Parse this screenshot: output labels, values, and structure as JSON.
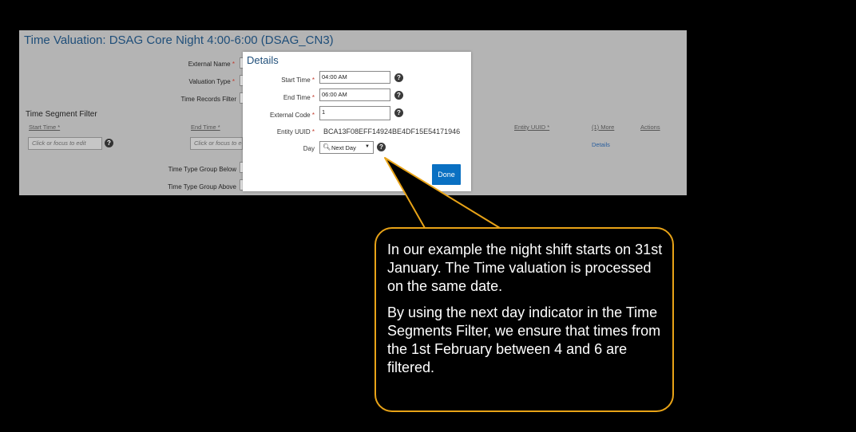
{
  "page": {
    "title": "Time Valuation: DSAG Core Night 4:00-6:00 (DSAG_CN3)"
  },
  "form": {
    "external_name_label": "External Name",
    "valuation_type_label": "Valuation Type",
    "time_records_filter_label": "Time Records Filter",
    "time_type_group_below_label": "Time Type Group Below",
    "time_type_group_above_label": "Time Type Group Above",
    "required_mark": "*"
  },
  "segment_filter": {
    "title": "Time Segment Filter",
    "columns": {
      "start_time": "Start Time *",
      "end_time": "End Time *",
      "entity_uuid": "Entity UUID *",
      "more": "(1) More",
      "actions": "Actions"
    },
    "start_placeholder": "Click or focus to edit",
    "end_placeholder": "Click or focus to edit",
    "details_link": "Details",
    "help": "?"
  },
  "dialog": {
    "title": "Details",
    "start_time_label": "Start Time",
    "start_time_value": "04:00 AM",
    "end_time_label": "End Time",
    "end_time_value": "06:00 AM",
    "external_code_label": "External Code",
    "external_code_value": "1",
    "entity_uuid_label": "Entity UUID",
    "entity_uuid_value": "BCA13F08EFF14924BE4DF15E54171946",
    "day_label": "Day",
    "day_value": "Next Day",
    "done_label": "Done",
    "required_mark": "*",
    "help": "?"
  },
  "callout": {
    "paragraph1": "In our example the night shift starts on 31st January. The Time valuation is processed on the same date.",
    "paragraph2": "By using the next day indicator in the Time Segments Filter, we ensure that times from the 1st February between 4 and 6 are filtered."
  },
  "colors": {
    "callout_border": "#e8a317",
    "primary_button": "#0a70c2",
    "title_blue": "#1f4e79"
  }
}
